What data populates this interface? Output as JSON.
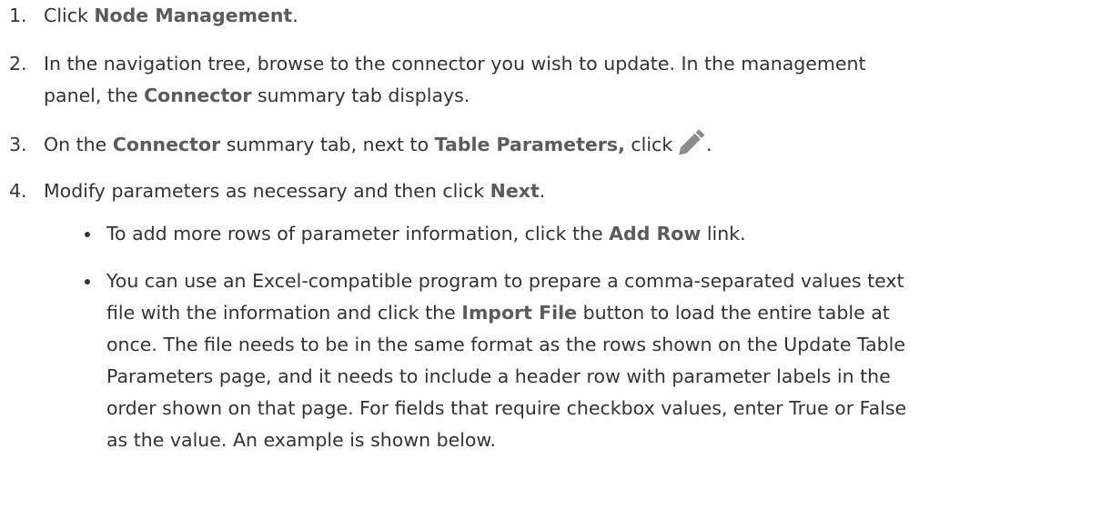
{
  "steps": [
    {
      "num": "1.",
      "pre": "Click ",
      "ui": "Node Management",
      "post": "."
    },
    {
      "num": "2.",
      "line1": "In the navigation tree, browse to the connector you wish to update. In the management",
      "line2_pre": "panel, the ",
      "line2_ui": "Connector",
      "line2_post": " summary tab displays."
    },
    {
      "num": "3.",
      "pre": "On the ",
      "ui1": "Connector",
      "mid": " summary tab, next to ",
      "ui2": "Table Parameters,",
      "post": " click",
      "end": ".",
      "icon": "pencil-edit-icon"
    },
    {
      "num": "4.",
      "pre": "Modify parameters as necessary and then click ",
      "ui": "Next",
      "post": "."
    }
  ],
  "bullets": [
    {
      "pre": "To add more rows of parameter information, click the ",
      "ui": "Add Row",
      "post": " link."
    },
    {
      "line1": "You can use an Excel-compatible program to prepare a comma-separated values text",
      "line2_pre": "file with the information and click the ",
      "line2_ui": "Import File",
      "line2_post": " button to load the entire table at",
      "line3": "once. The file needs to be in the same format as the rows shown on the Update Table",
      "line4": "Parameters page, and it needs to include a header row with parameter labels in the",
      "line5": "order shown on that page. For fields that require checkbox values, enter True or False",
      "line6": "as the value. An example is shown below."
    }
  ],
  "colors": {
    "text": "#333333",
    "ui_label": "#5b5b5b",
    "icon": "#8c8c8c"
  }
}
